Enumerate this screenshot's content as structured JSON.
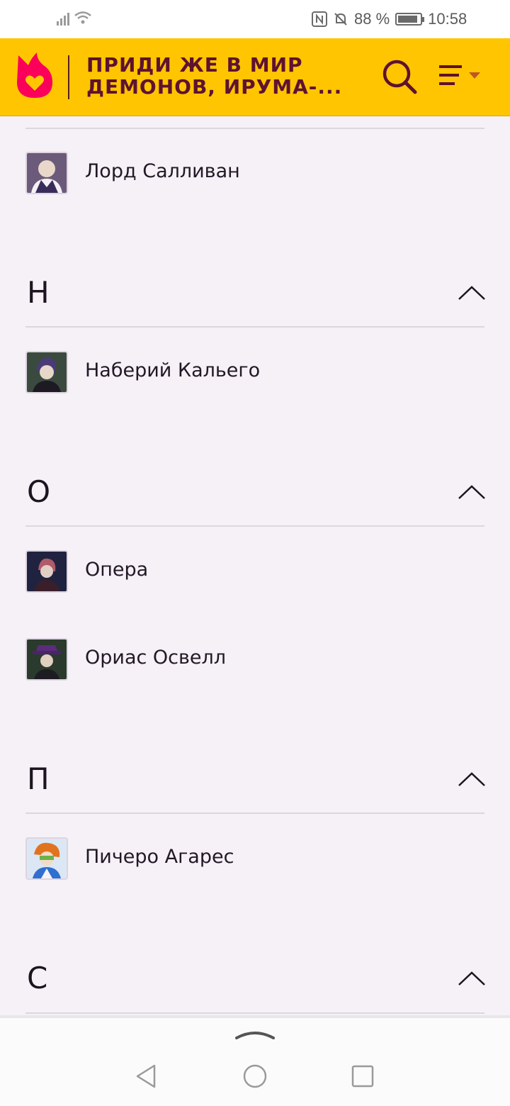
{
  "status_bar": {
    "battery": "88 %",
    "time": "10:58",
    "battery_level": 0.88
  },
  "header": {
    "title_line1": "ПРИДИ ЖЕ В МИР",
    "title_line2": "ДЕМОНОВ, ИРУМА-...",
    "logo_icon": "fandom-flame-heart-icon",
    "search_icon": "search-icon",
    "menu_icon": "menu-icon",
    "colors": {
      "bar": "#ffc500",
      "title": "#5e1230",
      "logo": "#fa005a"
    }
  },
  "sections": [
    {
      "letter": "",
      "items": [
        {
          "name": "Лорд Салливан",
          "avatar": "portrait-lord-sullivan"
        }
      ]
    },
    {
      "letter": "Н",
      "items": [
        {
          "name": "Наберий Кальего",
          "avatar": "portrait-naberius-kalego"
        }
      ]
    },
    {
      "letter": "О",
      "items": [
        {
          "name": "Опера",
          "avatar": "portrait-opera"
        },
        {
          "name": "Ориас Освелл",
          "avatar": "portrait-orias-oswell"
        }
      ]
    },
    {
      "letter": "П",
      "items": [
        {
          "name": "Пичеро Агарес",
          "avatar": "portrait-pichero-agares"
        }
      ]
    },
    {
      "letter": "С",
      "items": []
    }
  ],
  "nav": {
    "back_icon": "back-triangle-icon",
    "home_icon": "home-circle-icon",
    "recent_icon": "recent-square-icon"
  }
}
